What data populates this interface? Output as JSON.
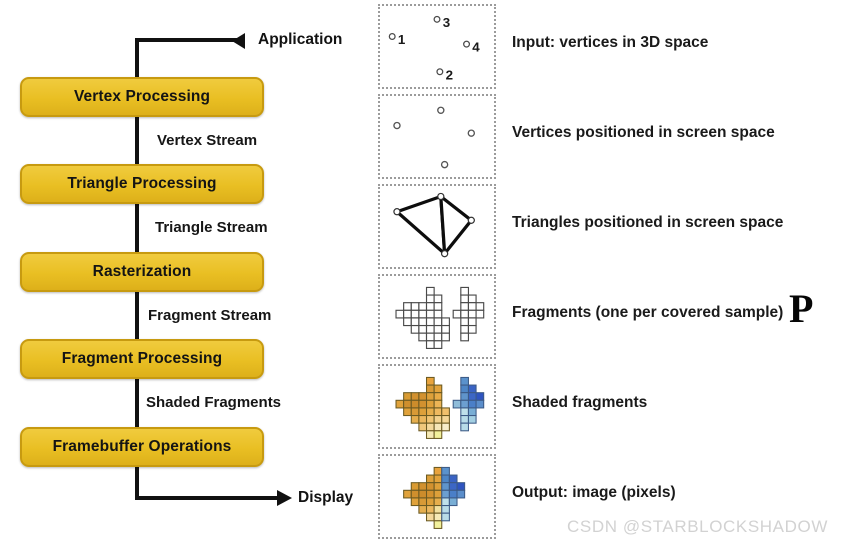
{
  "diagram": {
    "title": "Graphics Pipeline",
    "colors": {
      "box_fill": "#e9bf23",
      "box_fill_light": "#f0cb3e",
      "box_border": "#c79a10",
      "line": "#111111",
      "panel_border": "#9b9b9b",
      "text": "#141414",
      "watermark": "#d2d2d2",
      "orange": "#e8a33d",
      "orange_dark": "#d2912f",
      "yellow": "#f2ef9e",
      "blue": "#4e86c6",
      "blue_dark": "#2f54c0",
      "cyan_light": "#b8dce8"
    },
    "stages": [
      {
        "label": "Vertex Processing"
      },
      {
        "label": "Triangle Processing"
      },
      {
        "label": "Rasterization"
      },
      {
        "label": "Fragment Processing"
      },
      {
        "label": "Framebuffer Operations"
      }
    ],
    "streams": [
      {
        "label": "Vertex Stream"
      },
      {
        "label": "Triangle Stream"
      },
      {
        "label": "Fragment Stream"
      },
      {
        "label": "Shaded Fragments"
      }
    ],
    "endpoints": {
      "top": {
        "label": "Application",
        "arrow": "arrow-left-icon"
      },
      "bottom": {
        "label": "Display",
        "arrow": "arrow-right-icon"
      }
    }
  },
  "thumbnails": [
    {
      "id": "vertices-3d",
      "caption": "Input: vertices in 3D space",
      "vertex_labels": [
        "1",
        "2",
        "3",
        "4"
      ]
    },
    {
      "id": "vertices-screen",
      "caption": "Vertices positioned in screen space",
      "vertex_labels": []
    },
    {
      "id": "triangles-screen",
      "caption": "Triangles positioned in screen space",
      "vertex_labels": []
    },
    {
      "id": "fragments",
      "caption": "Fragments (one per covered sample)",
      "vertex_labels": []
    },
    {
      "id": "shaded-fragments",
      "caption": "Shaded fragments",
      "vertex_labels": []
    },
    {
      "id": "output-image",
      "caption": "Output: image (pixels)",
      "vertex_labels": []
    }
  ],
  "overlay": {
    "caret_glyph": "P"
  },
  "watermark": {
    "text": "CSDN @STARBLOCKSHADOW"
  }
}
